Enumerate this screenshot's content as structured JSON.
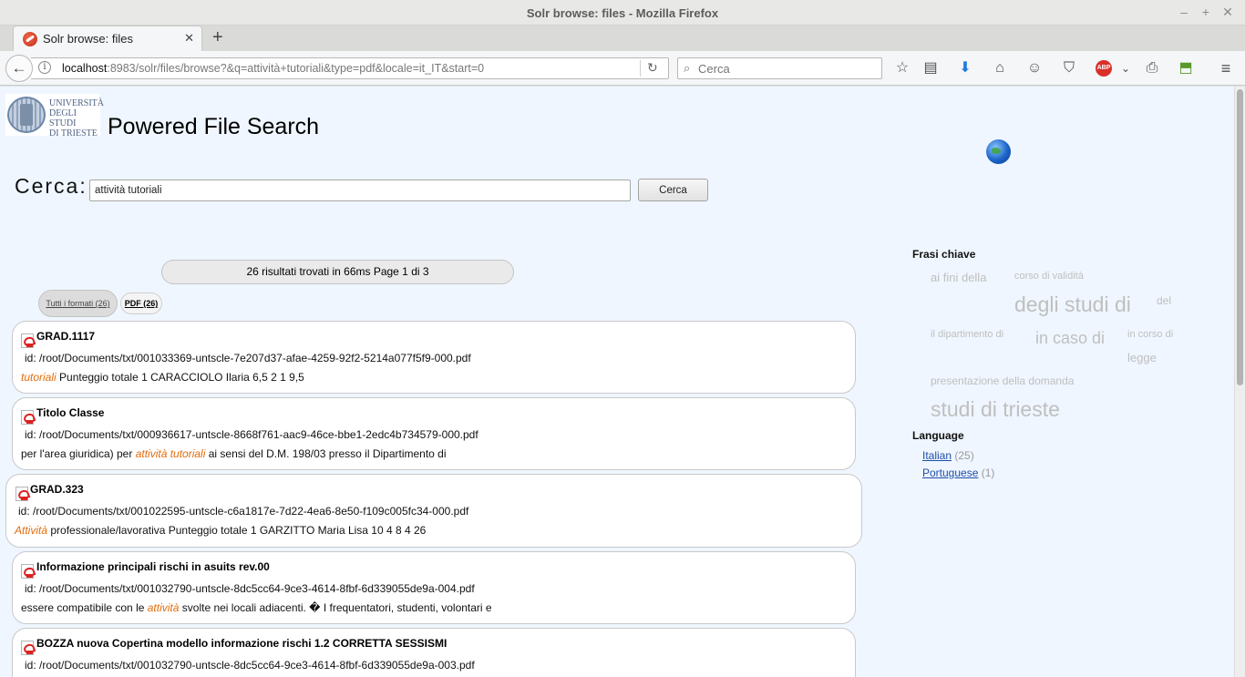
{
  "window": {
    "title": "Solr browse: files - Mozilla Firefox",
    "minimize": "–",
    "maximize": "+",
    "close": "✕"
  },
  "tab": {
    "label": "Solr browse: files",
    "close": "✕",
    "new_tab": "+"
  },
  "nav": {
    "url_host": "localhost",
    "url_path": ":8983/solr/files/browse?&q=attività+tutoriali&type=pdf&locale=it_IT&start=0",
    "search_placeholder": "Cerca"
  },
  "icons": [
    "back-icon",
    "info-icon",
    "reload-icon",
    "search-icon",
    "bookmark-star-icon",
    "reading-list-icon",
    "download-icon",
    "home-icon",
    "chat-icon",
    "pocket-icon",
    "adblock-plus-icon",
    "dropdown-icon",
    "print-icon",
    "pdf-tool-icon",
    "menu-icon",
    "pdf-file-icon",
    "globe-icon"
  ],
  "header": {
    "logo_lines": [
      "UNIVERSITÀ",
      "DEGLI STUDI",
      "DI TRIESTE"
    ],
    "title": "Powered File Search"
  },
  "search": {
    "label": "Cerca:",
    "query": "attività tutoriali",
    "button": "Cerca"
  },
  "results_info": "26 risultati trovati in 66ms Page 1 di 3",
  "formats": {
    "all": "Tutti i formati (26)",
    "pdf": "PDF (26)"
  },
  "results": [
    {
      "title": "GRAD.1117",
      "id": "id: /root/Documents/txt/001033369-untscle-7e207d37-afae-4259-92f2-5214a077f5f9-000.pdf",
      "snippet_parts": [
        {
          "text": "tutoriali",
          "hl": true
        },
        {
          "text": " Punteggio totale 1 CARACCIOLO Ilaria 6,5 2 1 9,5",
          "hl": false
        }
      ]
    },
    {
      "title": "Titolo Classe",
      "id": "id: /root/Documents/txt/000936617-untscle-8668f761-aac9-46ce-bbe1-2edc4b734579-000.pdf",
      "snippet_parts": [
        {
          "text": "per l'area giuridica) per ",
          "hl": false
        },
        {
          "text": "attività tutoriali",
          "hl": true
        },
        {
          "text": " ai sensi del D.M. 198/03 presso il Dipartimento di",
          "hl": false
        }
      ]
    },
    {
      "title": "GRAD.323",
      "id": "id: /root/Documents/txt/001022595-untscle-c6a1817e-7d22-4ea6-8e50-f109c005fc34-000.pdf",
      "snippet_parts": [
        {
          "text": "Attività",
          "hl": true
        },
        {
          "text": " professionale/lavorativa Punteggio totale 1 GARZITTO Maria Lisa 10 4 8 4 26",
          "hl": false
        }
      ]
    },
    {
      "title": "Informazione principali rischi in asuits rev.00",
      "id": "id: /root/Documents/txt/001032790-untscle-8dc5cc64-9ce3-4614-8fbf-6d339055de9a-004.pdf",
      "snippet_parts": [
        {
          "text": "essere compatibile con le ",
          "hl": false
        },
        {
          "text": "attività",
          "hl": true
        },
        {
          "text": " svolte nei locali adiacenti. � I frequentatori, studenti, volontari e",
          "hl": false
        }
      ]
    },
    {
      "title": "BOZZA nuova Copertina modello informazione rischi 1.2 CORRETTA SESSISMI",
      "id": "id: /root/Documents/txt/001032790-untscle-8dc5cc64-9ce3-4614-8fbf-6d339055de9a-003.pdf",
      "snippet_parts": []
    }
  ],
  "sidebar": {
    "frasi_title": "Frasi chiave",
    "cloud": [
      "ai fini della",
      "corso di validità",
      "degli studi di",
      "del",
      "il dipartimento di",
      "in caso di",
      "in corso di",
      "legge",
      "presentazione della domanda",
      "studi di trieste"
    ],
    "language_title": "Language",
    "languages": [
      {
        "name": "Italian",
        "count": "(25)"
      },
      {
        "name": "Portuguese",
        "count": "(1)"
      }
    ]
  }
}
